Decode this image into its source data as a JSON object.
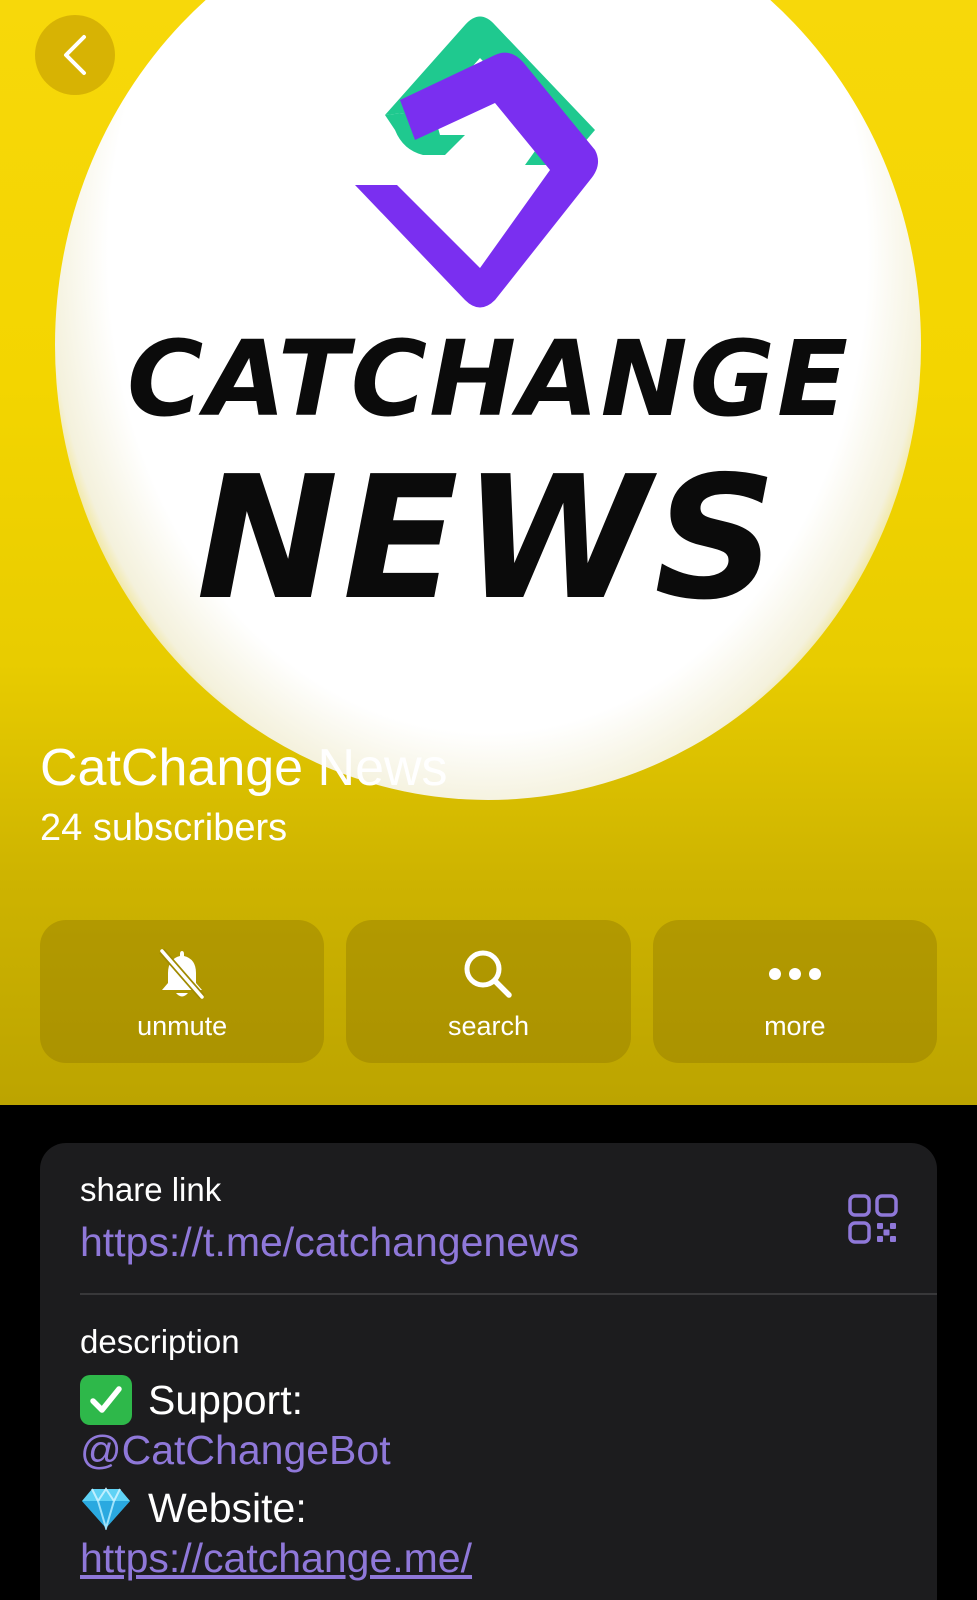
{
  "channel": {
    "title": "CatChange News",
    "subscribers": "24 subscribers",
    "logo_line1": "CATCHANGE",
    "logo_line2": "NEWS"
  },
  "actions": [
    {
      "label": "unmute",
      "icon": "bell-slash-icon"
    },
    {
      "label": "search",
      "icon": "search-icon"
    },
    {
      "label": "more",
      "icon": "ellipsis-icon"
    }
  ],
  "info": {
    "share_label": "share link",
    "share_url": "https://t.me/catchangenews",
    "description_label": "description",
    "support_text": "Support:",
    "support_handle": "@CatChangeBot",
    "website_text": "Website:",
    "website_url": "https://catchange.me/"
  },
  "colors": {
    "header_yellow": "#f3d500",
    "link_purple": "#8f78d9",
    "card_bg": "#1c1c1e",
    "logo_green": "#1fc98f",
    "logo_purple": "#7a2ff0"
  }
}
